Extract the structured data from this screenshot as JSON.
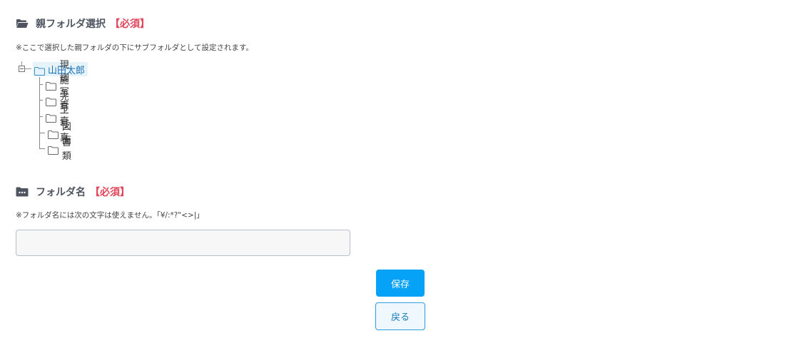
{
  "parent_section": {
    "title": "親フォルダ選択",
    "required": "【必須】",
    "note": "※ここで選択した親フォルダの下にサブフォルダとして設定されます。",
    "icon": "folder-open-icon"
  },
  "tree": {
    "root": {
      "label": "山田太郎",
      "icon": "folder-icon",
      "selected": true
    },
    "children": [
      {
        "label": "現調写真"
      },
      {
        "label": "施工写真"
      },
      {
        "label": "完工写真"
      },
      {
        "label": "図面"
      },
      {
        "label": "書類"
      }
    ]
  },
  "name_section": {
    "title": "フォルダ名",
    "required": "【必須】",
    "note": "※フォルダ名には次の文字は使えません。「¥/:*?\"<>|」",
    "icon": "folder-dots-icon",
    "input_value": "",
    "input_placeholder": ""
  },
  "buttons": {
    "save": "保存",
    "back": "戻る"
  },
  "colors": {
    "required": "#e0455a",
    "primary": "#05a2f7",
    "selected_bg": "#e6f3fb",
    "selected_text": "#1a6fb0"
  }
}
